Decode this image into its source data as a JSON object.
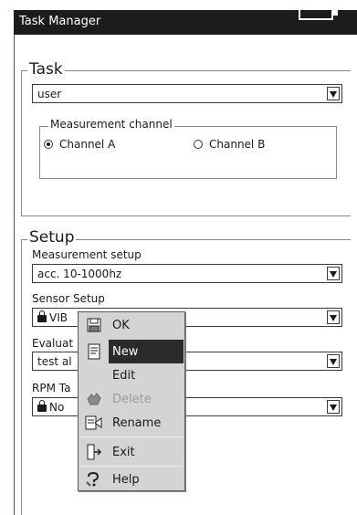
{
  "window": {
    "title": "Task Manager"
  },
  "task": {
    "legend": "Task",
    "selected": "user",
    "channel": {
      "legend": "Measurement channel",
      "options": [
        "Channel A",
        "Channel B"
      ],
      "selected": "Channel A"
    }
  },
  "setup": {
    "legend": "Setup",
    "measurement": {
      "label": "Measurement setup",
      "value": "acc. 10-1000hz"
    },
    "sensor": {
      "label": "Sensor Setup",
      "value": "VIB"
    },
    "evaluation": {
      "label": "Evaluat",
      "value": "test al"
    },
    "rpm": {
      "label": "RPM Ta",
      "value": "No"
    }
  },
  "context_menu": {
    "items": [
      {
        "label": "OK",
        "icon": "save-icon",
        "state": "normal"
      },
      {
        "label": "New",
        "icon": "new-document-icon",
        "state": "selected"
      },
      {
        "label": "Edit",
        "icon": "",
        "state": "normal"
      },
      {
        "label": "Delete",
        "icon": "delete-icon",
        "state": "disabled"
      },
      {
        "label": "Rename",
        "icon": "rename-icon",
        "state": "normal"
      },
      {
        "label": "Exit",
        "icon": "exit-icon",
        "state": "normal"
      },
      {
        "label": "Help",
        "icon": "help-icon",
        "state": "normal"
      }
    ]
  },
  "colors": {
    "titlebar": "#1c1c1c",
    "menu_bg": "#d4d4d4",
    "selected": "#2b2b2b"
  }
}
